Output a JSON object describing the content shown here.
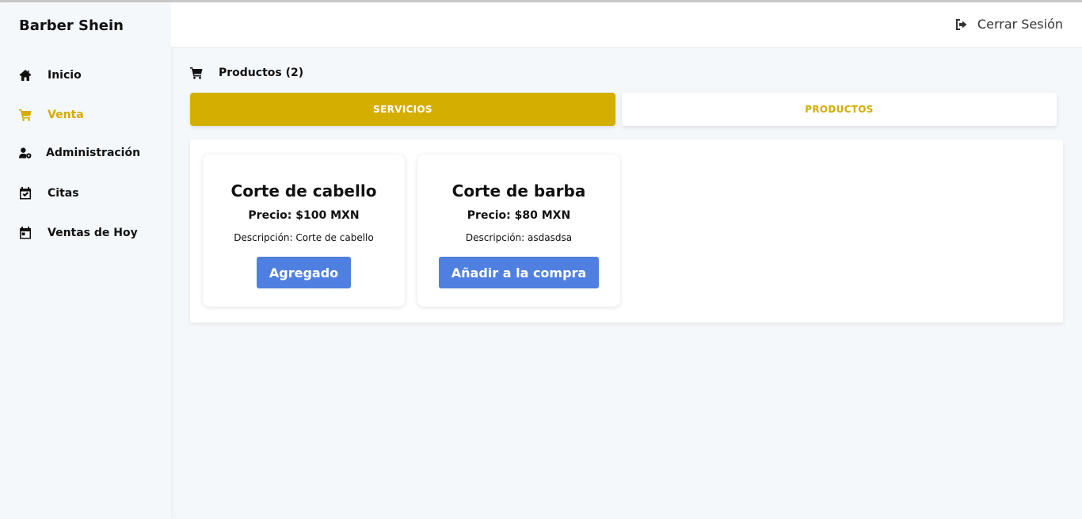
{
  "brand": "Barber Shein",
  "sidebar": {
    "items": [
      {
        "label": "Inicio",
        "icon": "home-icon"
      },
      {
        "label": "Venta",
        "icon": "cart-icon",
        "active": true
      },
      {
        "label": "Administración",
        "icon": "user-cog-icon"
      },
      {
        "label": "Citas",
        "icon": "calendar-check-icon"
      },
      {
        "label": "Ventas de Hoy",
        "icon": "calendar-icon"
      }
    ]
  },
  "header": {
    "logout_label": "Cerrar Sesión",
    "logout_icon": "sign-out-icon"
  },
  "cart": {
    "label": "Productos (2)",
    "icon": "cart-icon"
  },
  "tabs": [
    {
      "label": "SERVICIOS",
      "active": true
    },
    {
      "label": "PRODUCTOS",
      "active": false
    }
  ],
  "cards": [
    {
      "title": "Corte de cabello",
      "price": "Precio: $100 MXN",
      "description": "Descripción: Corte de cabello",
      "button": "Agregado"
    },
    {
      "title": "Corte de barba",
      "price": "Precio: $80 MXN",
      "description": "Descripción: asdasdsa",
      "button": "Añadir a la compra"
    }
  ],
  "colors": {
    "accent": "#d4ae00",
    "button": "#4f80e1",
    "background": "#f5f8fb"
  }
}
